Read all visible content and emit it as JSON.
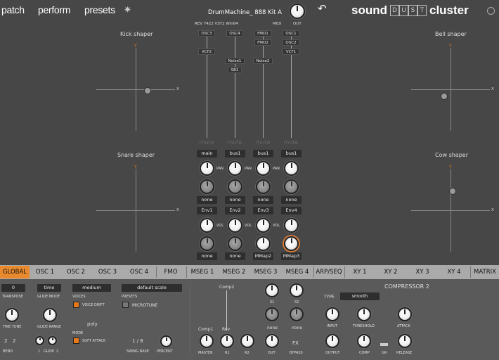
{
  "nav": {
    "patch": "patch",
    "perform": "perform",
    "presets": "presets"
  },
  "preset_name": "DrumMachine_ 888 Kit A",
  "rev": "REV 7422  VST2 Win64",
  "midi": "MIDI",
  "out": "OUT",
  "brand": {
    "sound": "sound",
    "dust": [
      "D",
      "U",
      "S",
      "T"
    ],
    "cluster": "cluster"
  },
  "shapers": {
    "kick": "Kick shaper",
    "bell": "Bell shaper",
    "snare": "Snare shaper",
    "cow": "Cow shaper",
    "x": "X",
    "y": "Y"
  },
  "routing": {
    "osc3": "OSC3",
    "osc4": "OSC4",
    "fmo1": "FMO1",
    "osc1": "OSC1",
    "vcf2": "VCF2",
    "fmo2": "FMO2",
    "osc2": "OSC2",
    "vcf1": "VCF1",
    "noise1": "Noise1",
    "noise2": "Noise2",
    "sb1": "SB1"
  },
  "mute": "mute",
  "bus": [
    "main",
    "bus1",
    "bus1",
    "bus1"
  ],
  "pan": "PAN",
  "vol": "VOL",
  "none": "none",
  "env": [
    "Env1",
    "Env2",
    "Env3",
    "Env4"
  ],
  "bottom_sel": [
    "none",
    "none",
    "MMap2",
    "MMap3"
  ],
  "tabs": [
    "GLOBAL",
    "OSC 1",
    "OSC 2",
    "OSC 3",
    "OSC 4",
    "FMO",
    "MSEG 1",
    "MSEG 2",
    "MSEG 3",
    "MSEG 4",
    "ARP/SEQ",
    "XY 1",
    "XY 2",
    "XY 3",
    "XY 4",
    "MATRIX"
  ],
  "global": {
    "transpose_val": "0",
    "transpose": "TRANSPOSE",
    "glide_mode_val": "time",
    "glide_mode": "GLIDE MODE",
    "voices_val": "medium",
    "voices": "VOICES",
    "voice_drift": "VOICE DRIFT",
    "presets_val": "default scale",
    "presets": "PRESETS",
    "microtune": "MICROTUNE",
    "fine_tune": "FINE TUNE",
    "glide_range": "GLIDE RANGE",
    "poly": "poly",
    "mode": "MODE",
    "soft_attack": "SOFT ATTACK",
    "bend_l": "2",
    "bend_r": "2",
    "bend": "BEND",
    "glide_l": "1",
    "glide_r": "2",
    "glide": "GLIDE",
    "swing_val": "1 / 8",
    "swing_base": "SWING BASE",
    "percent": "PERCENT",
    "comp2": "Comp2",
    "comp1": "Comp1",
    "rev": "Rev",
    "master": "MASTER",
    "r1": "R1",
    "r2": "R2",
    "s1": "S1",
    "s2": "S2",
    "out": "OUT",
    "fx": "FX",
    "bypass": "BYPASS",
    "compressor": "COMPRESSOR 2",
    "type": "TYPE",
    "type_val": "smooth",
    "input": "INPUT",
    "threshold": "THRESHOLD",
    "attack": "ATTACK",
    "output": "OUTPUT",
    "comp": "COMP",
    "gr": "GR",
    "release": "RELEASE"
  }
}
